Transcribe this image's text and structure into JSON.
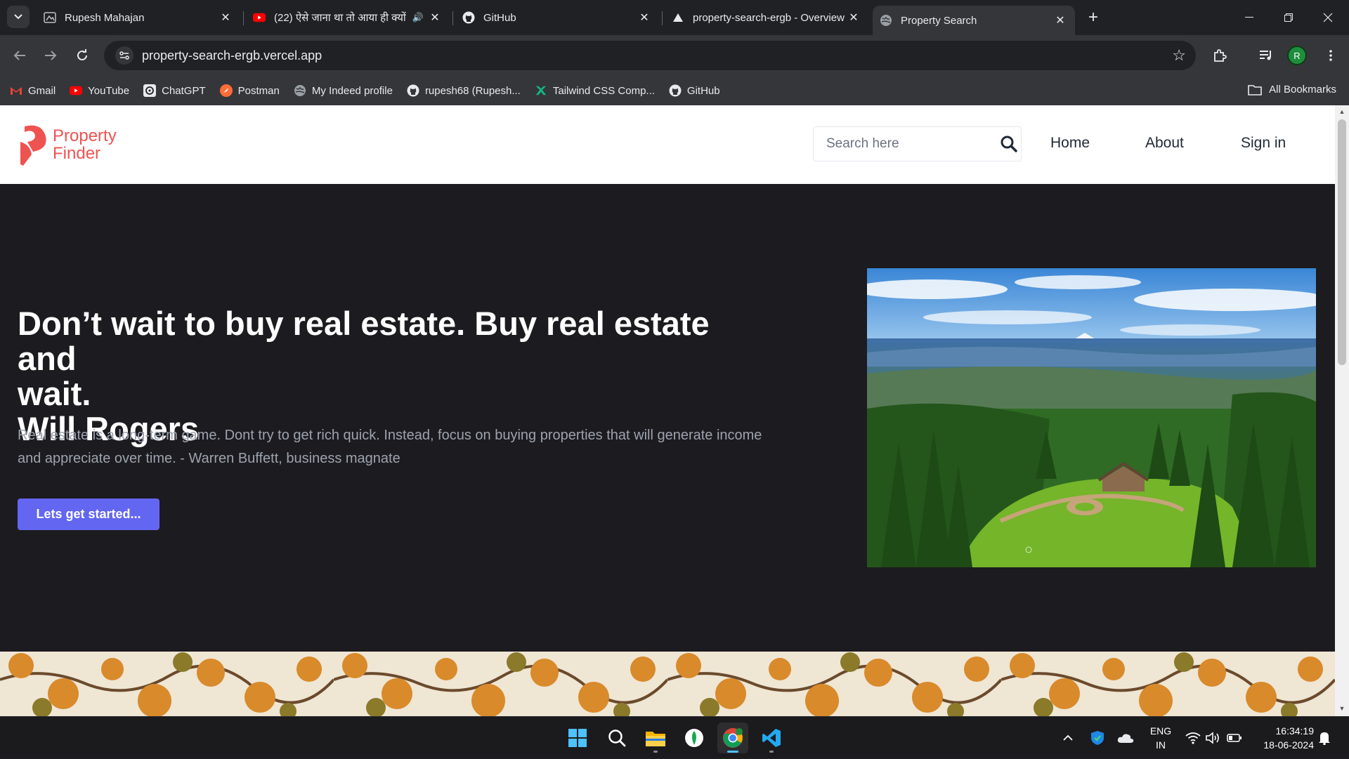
{
  "browser": {
    "tabs": [
      {
        "title": "Rupesh Mahajan",
        "icon": "profile-favicon",
        "active": false
      },
      {
        "title": "(22) ऐसे जाना था तो आया ही क्यों",
        "icon": "youtube-favicon",
        "active": false,
        "audio": true
      },
      {
        "title": "GitHub",
        "icon": "github-favicon",
        "active": false
      },
      {
        "title": "property-search-ergb - Overview",
        "icon": "vercel-favicon",
        "active": false
      },
      {
        "title": "Property Search",
        "icon": "globe-favicon",
        "active": true
      }
    ],
    "url": "property-search-ergb.vercel.app",
    "profile_initial": "R",
    "bookmarks": [
      {
        "label": "Gmail",
        "icon": "gmail-icon"
      },
      {
        "label": "YouTube",
        "icon": "youtube-icon"
      },
      {
        "label": "ChatGPT",
        "icon": "chatgpt-icon"
      },
      {
        "label": "Postman",
        "icon": "postman-icon"
      },
      {
        "label": "My Indeed profile",
        "icon": "globe-icon"
      },
      {
        "label": "rupesh68 (Rupesh...",
        "icon": "github-icon"
      },
      {
        "label": "Tailwind CSS Comp...",
        "icon": "tailwind-icon"
      },
      {
        "label": "GitHub",
        "icon": "github-icon"
      }
    ],
    "all_bookmarks_label": "All Bookmarks"
  },
  "site": {
    "logo": {
      "line1": "Property",
      "line2": "Finder",
      "color": "#ef5350"
    },
    "search_placeholder": "Search here",
    "nav": {
      "home": "Home",
      "about": "About",
      "signin": "Sign in"
    },
    "hero": {
      "title_line1": "Don’t wait to buy real estate. Buy real estate and",
      "title_line2": "wait.",
      "title_line3": "Will Rogers",
      "subtitle": "Real estate is a long-term game. Dont try to get rich quick. Instead, focus on buying properties that will generate income and appreciate over time. - Warren Buffett, business magnate",
      "cta_label": "Lets get started...",
      "cta_color": "#6366f1"
    }
  },
  "taskbar": {
    "apps": [
      "windows-start-icon",
      "search-icon",
      "file-explorer-icon",
      "mongodb-compass-icon",
      "chrome-icon",
      "vscode-icon"
    ],
    "lang_line1": "ENG",
    "lang_line2": "IN",
    "time": "16:34:19",
    "date": "18-06-2024"
  }
}
